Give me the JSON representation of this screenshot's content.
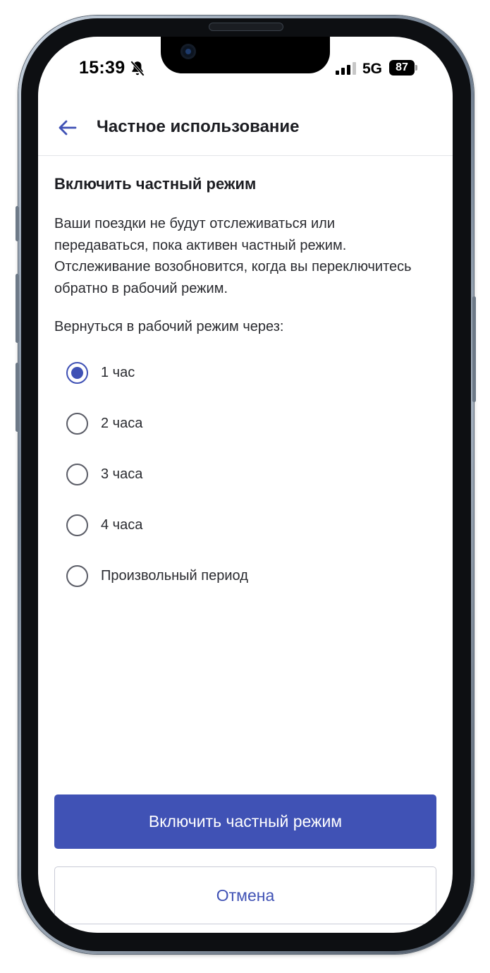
{
  "status_bar": {
    "time": "15:39",
    "mute_icon": "bell-slash-icon",
    "signal_icon": "cellular-signal-icon",
    "network": "5G",
    "battery": "87"
  },
  "header": {
    "back_icon": "arrow-left-icon",
    "title": "Частное использование"
  },
  "content": {
    "section_title": "Включить частный режим",
    "description": "Ваши поездки не будут отслеживаться или передаваться, пока активен частный режим. Отслеживание возобновится, когда вы переключитесь обратно в рабочий режим.",
    "return_label": "Вернуться в рабочий режим через:",
    "options": [
      {
        "label": "1 час",
        "selected": true
      },
      {
        "label": "2 часа",
        "selected": false
      },
      {
        "label": "3 часа",
        "selected": false
      },
      {
        "label": "4 часа",
        "selected": false
      },
      {
        "label": "Произвольный период",
        "selected": false
      }
    ]
  },
  "actions": {
    "primary_label": "Включить частный режим",
    "secondary_label": "Отмена"
  },
  "colors": {
    "accent": "#4052b5",
    "text": "#1c1d22",
    "radio_border": "#5a5c66",
    "divider": "#e3e4e8"
  }
}
